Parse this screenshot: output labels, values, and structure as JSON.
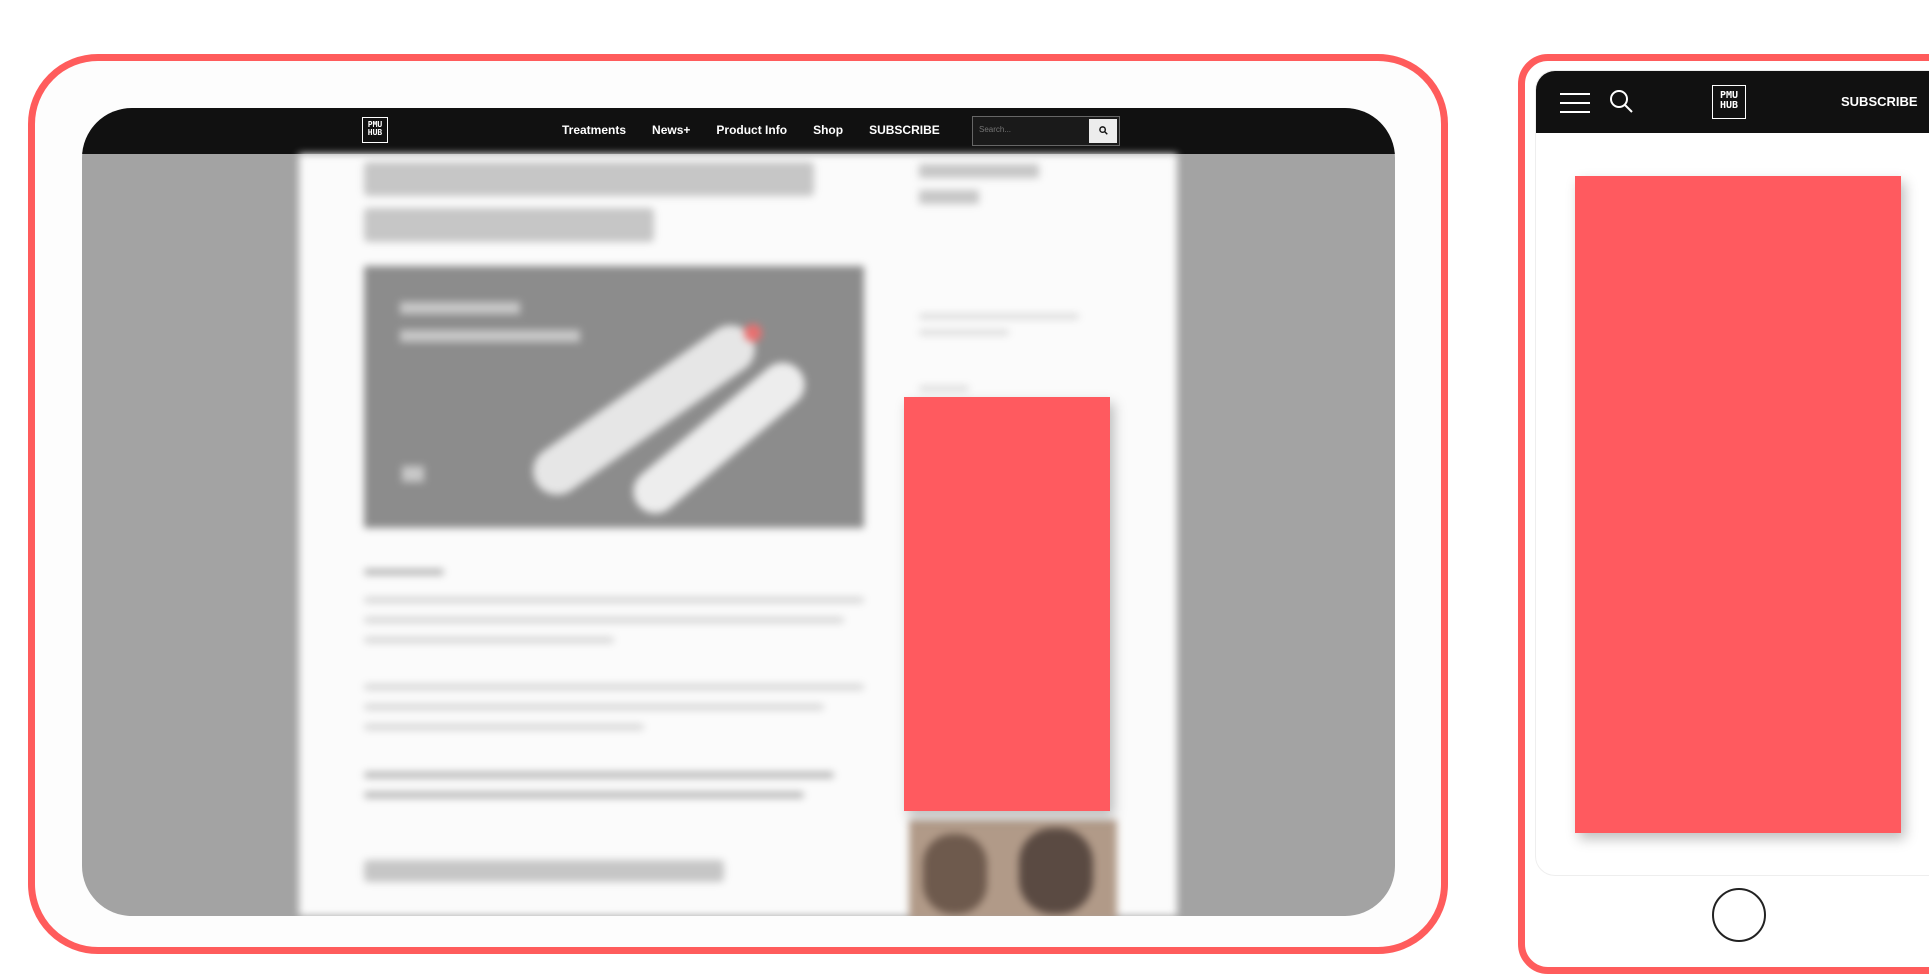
{
  "brand": {
    "logo_text": "PMU HUB",
    "accent_color": "#ff5a5f",
    "frame_color": "#ff5c5c",
    "nav_color": "#111111"
  },
  "desktop": {
    "nav": {
      "links": [
        "Treatments",
        "News+",
        "Product Info",
        "Shop",
        "SUBSCRIBE"
      ],
      "search_placeholder": "Search..."
    }
  },
  "mobile": {
    "nav": {
      "subscribe_label": "SUBSCRIBE"
    }
  },
  "icons": {
    "menu": "hamburger-icon",
    "search": "search-icon",
    "home": "home-button-icon"
  }
}
